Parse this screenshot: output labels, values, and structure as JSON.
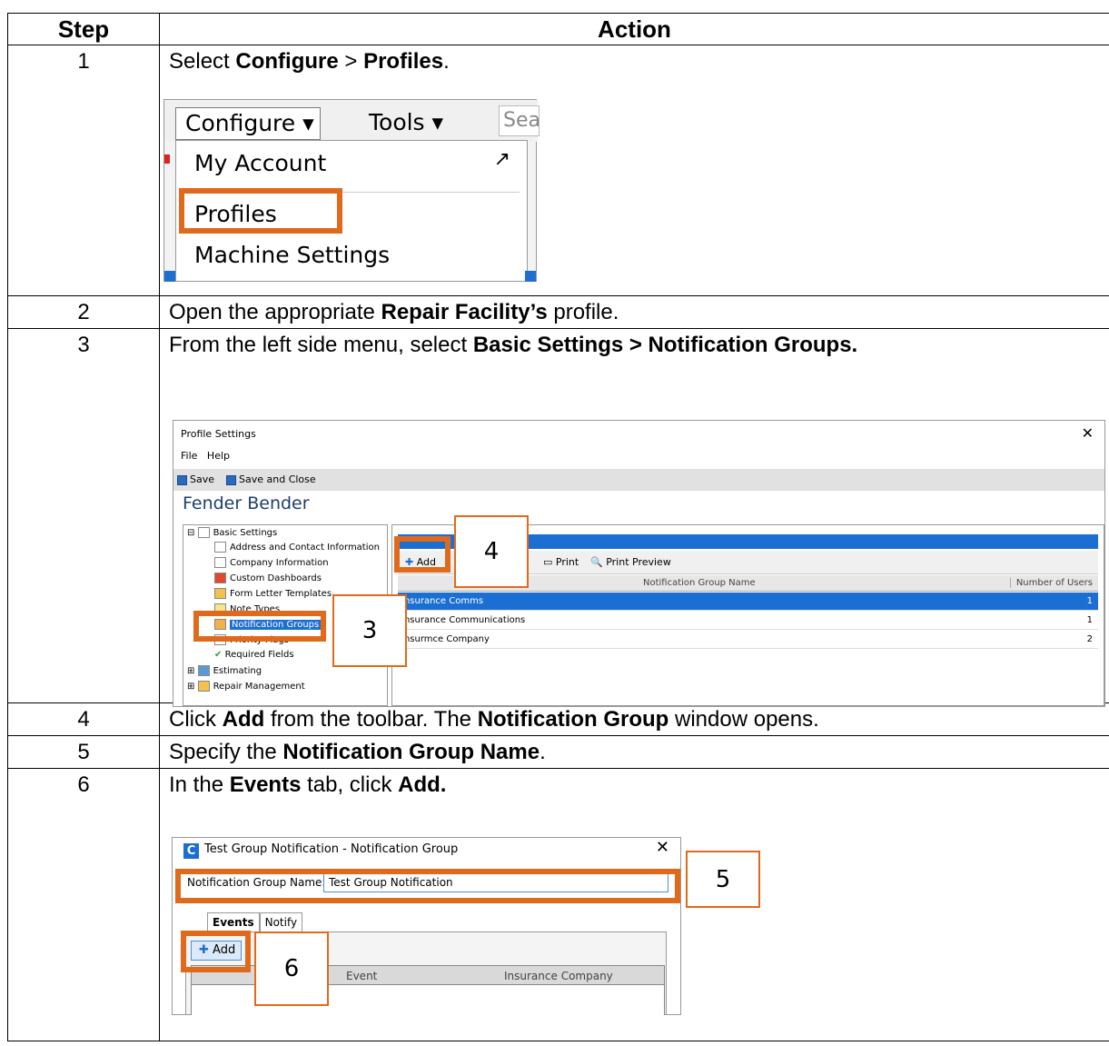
{
  "table": {
    "header_step": "Step",
    "header_action": "Action"
  },
  "steps": [
    {
      "num": "1",
      "text_pre": "Select ",
      "b1": "Configure",
      "mid": " > ",
      "b2": "Profiles",
      "text_post": "."
    },
    {
      "num": "2",
      "text_pre": "Open the appropriate ",
      "b1": "Repair Facility’s",
      "text_post": " profile."
    },
    {
      "num": "3",
      "text_pre": "From the left side menu, select ",
      "b1": "Basic Settings > Notification Groups."
    },
    {
      "num": "4",
      "text_pre": "Click ",
      "b1": "Add",
      "mid": " from the toolbar. The ",
      "b2": "Notification Group",
      "text_post": " window opens."
    },
    {
      "num": "5",
      "text_pre": "Specify the ",
      "b1": "Notification Group Name",
      "text_post": "."
    },
    {
      "num": "6",
      "text_pre": "In the ",
      "b1": "Events",
      "mid": " tab, click ",
      "b2": "Add."
    }
  ],
  "shot_configure": {
    "configure_label": "Configure ▾",
    "tools_label": "Tools ▾",
    "search_stub": "Sea",
    "menu_items": [
      "My Account",
      "Profiles",
      "Machine Settings"
    ],
    "external_glyph": "↗"
  },
  "shot_profile": {
    "window_title": "Profile Settings",
    "menu": [
      "File",
      "Help"
    ],
    "toolbar": [
      "Save",
      "Save and Close"
    ],
    "company_name": "Fender Bender",
    "tree": {
      "basic_settings": "Basic Settings",
      "children": [
        "Address and Contact Information",
        "Company Information",
        "Custom Dashboards",
        "Form Letter Templates",
        "Note Types",
        "Notification Groups",
        "Priority Flags",
        "Required Fields"
      ],
      "estimating": "Estimating",
      "repair_management": "Repair Management"
    },
    "grid_toolbar": [
      "Add",
      "Print",
      "Print Preview"
    ],
    "columns": [
      "Notification Group Name",
      "Number of Users"
    ],
    "rows": [
      {
        "name": "Insurance Comms",
        "users": "1"
      },
      {
        "name": "Insurance Communications",
        "users": "1"
      },
      {
        "name": "Insurmce Company",
        "users": "2"
      }
    ],
    "callout_add": "4",
    "callout_tree": "3"
  },
  "shot_group": {
    "window_title": "Test Group Notification - Notification Group",
    "name_label": "Notification Group Name:",
    "name_value": "Test Group Notification",
    "tabs": [
      "Events",
      "Notify"
    ],
    "add_label": "Add",
    "columns": [
      "Event",
      "Insurance Company"
    ],
    "callout_name": "5",
    "callout_add": "6"
  },
  "colors": {
    "highlight_orange": "#e06a1b",
    "selection_blue": "#1c6fd2"
  }
}
